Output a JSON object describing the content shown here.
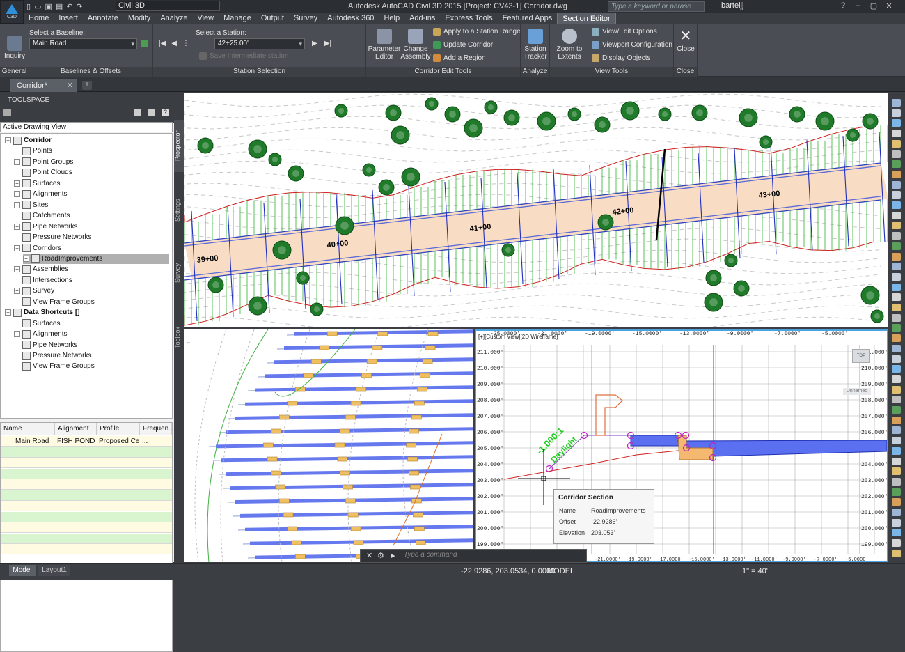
{
  "title": {
    "workspace": "Civil 3D",
    "window_title": "Autodesk AutoCAD Civil 3D 2015 [Project: CV43-1]    Corridor.dwg",
    "search_placeholder": "Type a keyword or phrase",
    "user": "barteljj"
  },
  "app_button": {
    "label": "C3D"
  },
  "menu_tabs": [
    "Home",
    "Insert",
    "Annotate",
    "Modify",
    "Analyze",
    "View",
    "Manage",
    "Output",
    "Survey",
    "Autodesk 360",
    "Help",
    "Add-ins",
    "Express Tools",
    "Featured Apps",
    "Section Editor"
  ],
  "ribbon": {
    "general": {
      "panel": "General",
      "inquiry": "Inquiry"
    },
    "baselines": {
      "panel": "Baselines & Offsets",
      "select_label": "Select a Baseline:",
      "baseline_value": "Main Road"
    },
    "station": {
      "panel": "Station Selection",
      "select_label": "Select a Station:",
      "station_value": "42+25.00'",
      "save_label": "Save Intermediate station"
    },
    "corridor": {
      "panel": "Corridor Edit Tools",
      "parameter_editor": "Parameter Editor",
      "change_assembly": "Change Assembly",
      "apply_range": "Apply to a Station Range",
      "update_corridor": "Update Corridor",
      "add_region": "Add a Region"
    },
    "analyze": {
      "panel": "Analyze",
      "station_tracker": "Station Tracker"
    },
    "view": {
      "panel": "View Tools",
      "zoom_extents": "Zoom to Extents",
      "view_edit": "View/Edit Options",
      "viewport_config": "Viewport Configuration",
      "display_objects": "Display Objects"
    },
    "close": {
      "panel": "Close",
      "close": "Close"
    }
  },
  "doc_tab": "Corridor*",
  "toolspace": {
    "title": "TOOLSPACE",
    "view_combo": "Active Drawing View",
    "side_tabs": [
      "Prospector",
      "Settings",
      "Survey",
      "Toolbox"
    ],
    "tree": [
      {
        "label": "Corridor",
        "depth": 0,
        "exp": "−"
      },
      {
        "label": "Points",
        "depth": 1,
        "exp": ""
      },
      {
        "label": "Point Groups",
        "depth": 1,
        "exp": "+"
      },
      {
        "label": "Point Clouds",
        "depth": 1,
        "exp": ""
      },
      {
        "label": "Surfaces",
        "depth": 1,
        "exp": "+"
      },
      {
        "label": "Alignments",
        "depth": 1,
        "exp": "+"
      },
      {
        "label": "Sites",
        "depth": 1,
        "exp": "+"
      },
      {
        "label": "Catchments",
        "depth": 1,
        "exp": ""
      },
      {
        "label": "Pipe Networks",
        "depth": 1,
        "exp": "+"
      },
      {
        "label": "Pressure Networks",
        "depth": 1,
        "exp": ""
      },
      {
        "label": "Corridors",
        "depth": 1,
        "exp": "−"
      },
      {
        "label": "RoadImprovements",
        "depth": 2,
        "exp": "+"
      },
      {
        "label": "Assemblies",
        "depth": 1,
        "exp": "+"
      },
      {
        "label": "Intersections",
        "depth": 1,
        "exp": ""
      },
      {
        "label": "Survey",
        "depth": 1,
        "exp": "+"
      },
      {
        "label": "View Frame Groups",
        "depth": 1,
        "exp": ""
      },
      {
        "label": "Data Shortcuts []",
        "depth": 0,
        "exp": "−"
      },
      {
        "label": "Surfaces",
        "depth": 1,
        "exp": ""
      },
      {
        "label": "Alignments",
        "depth": 1,
        "exp": "+"
      },
      {
        "label": "Pipe Networks",
        "depth": 1,
        "exp": ""
      },
      {
        "label": "Pressure Networks",
        "depth": 1,
        "exp": ""
      },
      {
        "label": "View Frame Groups",
        "depth": 1,
        "exp": ""
      }
    ],
    "grid_headers": [
      "Name",
      "Alignment",
      "Profile",
      "Frequen..."
    ],
    "grid_row": [
      "Main Road",
      "FISH POND R",
      "Proposed Cer",
      "..."
    ]
  },
  "top_view": {
    "stations": [
      "39+00",
      "40+00",
      "41+00",
      "42+00",
      "43+00"
    ]
  },
  "section_view": {
    "label": "[+][Custom View][2D Wireframe]",
    "elevations": [
      "211.000'",
      "210.000'",
      "209.000'",
      "208.000'",
      "207.000'",
      "206.000'",
      "205.000'",
      "204.000'",
      "203.000'",
      "202.000'",
      "201.000'",
      "200.000'",
      "199.000'"
    ],
    "offsets_top": [
      "-25.0000'",
      "-21.0000'",
      "-19.0000'",
      "-15.0000'",
      "-13.0000'",
      "-9.0000'",
      "-7.0000'",
      "-5.0000'"
    ],
    "offsets_bottom": [
      "-21.0000'",
      "-19.0000'",
      "-17.0000'",
      "-15.0000'",
      "-13.0000'",
      "-11.0000'",
      "-9.0000'",
      "-7.0000'",
      "-5.0000'"
    ],
    "slope_label": "-1.000:1",
    "daylight_label": "Daylight",
    "viewcube_top": "TOP",
    "unnamed": "Unnamed"
  },
  "tooltip": {
    "title": "Corridor Section",
    "rows": [
      [
        "Name",
        "RoadImprovements"
      ],
      [
        "Offset",
        "-22.9286'"
      ],
      [
        "Elevation",
        "203.053'"
      ]
    ]
  },
  "command_line": {
    "placeholder": "Type a command"
  },
  "status": {
    "model_tab": "Model",
    "layout_tab": "Layout1",
    "coords": "-22.9286, 203.0534, 0.0000",
    "model_btn": "MODEL",
    "scale": "1\" = 40'"
  },
  "colors": {
    "accent": "#4aa3e0",
    "road": "#f8dcc4",
    "daylight": "#22cc22",
    "assembly_blue": "#6678ee"
  }
}
